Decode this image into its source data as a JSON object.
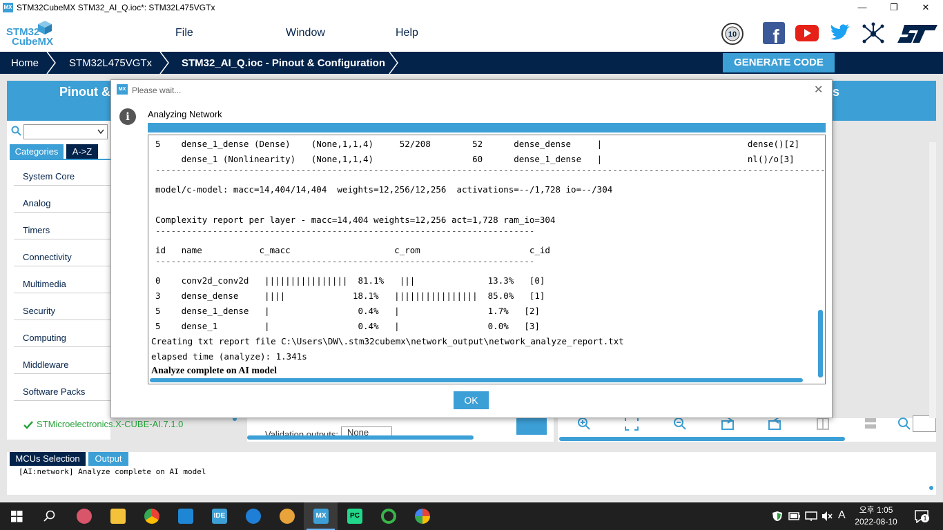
{
  "window": {
    "app_icon": "MX",
    "title": "STM32CubeMX STM32_AI_Q.ioc*: STM32L475VGTx",
    "minimize": "—",
    "maximize": "❐",
    "close": "✕"
  },
  "menu": {
    "logo_line1": "STM32",
    "logo_line2": "CubeMX",
    "items": [
      "File",
      "Window",
      "Help"
    ],
    "social_icons": [
      "anniversary-badge-icon",
      "facebook-icon",
      "youtube-icon",
      "twitter-icon",
      "network-icon",
      "st-logo-icon"
    ]
  },
  "breadcrumb": {
    "items": [
      "Home",
      "STM32L475VGTx",
      "STM32_AI_Q.ioc - Pinout & Configuration"
    ],
    "generate_button": "GENERATE CODE"
  },
  "background": {
    "left_tab_label": "Pinout &",
    "right_tab_label": "s",
    "tabs": [
      "Categories",
      "A->Z"
    ],
    "categories": [
      "System Core",
      "Analog",
      "Timers",
      "Connectivity",
      "Multimedia",
      "Security",
      "Computing",
      "Middleware",
      "Software Packs"
    ],
    "pack_item": "STMicroelectronics.X-CUBE-AI.7.1.0",
    "validation_label": "Validation outputs:",
    "validation_value": "None",
    "bottom_tabs": [
      "MCUs Selection",
      "Output"
    ],
    "console_text": "[AI:network]  Analyze complete on AI model"
  },
  "dialog": {
    "icon": "MX",
    "title": "Please wait...",
    "close": "✕",
    "info_glyph": "i",
    "message": "Analyzing Network",
    "ok_button": "OK",
    "log_lines": [
      "5    dense_1_dense (Dense)    (None,1,1,4)     52/208        52      dense_dense     |                            dense()[2]",
      "     dense_1 (Nonlinearity)   (None,1,1,4)                   60      dense_1_dense   |                            nl()/o[3]",
      "---------------------------------------------------------------------------------------------------------------------------------------",
      "model/c-model: macc=14,404/14,404  weights=12,256/12,256  activations=--/1,728 io=--/304",
      "",
      "Complexity report per layer - macc=14,404 weights=12,256 act=1,728 ram_io=304",
      "-------------------------------------------------------------------------",
      "id   name           c_macc                    c_rom                     c_id",
      "-------------------------------------------------------------------------",
      "0    conv2d_conv2d   ||||||||||||||||  81.1%   |||              13.3%   [0]",
      "3    dense_dense     ||||             18.1%   ||||||||||||||||  85.0%   [1]",
      "5    dense_1_dense   |                 0.4%   |                 1.7%   [2]",
      "5    dense_1         |                 0.4%   |                 0.0%   [3]"
    ],
    "report_line": "Creating txt report file C:\\Users\\DW\\.stm32cubemx\\network_output\\network_analyze_report.txt",
    "elapsed_line": "elapsed time (analyze): 1.341s",
    "complete_line": "Analyze complete on AI model"
  },
  "taskbar": {
    "ime": "A",
    "clock_time": "오후 1:05",
    "clock_date": "2022-08-10",
    "notifications": "1"
  },
  "colors": {
    "accent": "#3c9fd6",
    "navy": "#03234b",
    "taskbar": "#202020"
  }
}
